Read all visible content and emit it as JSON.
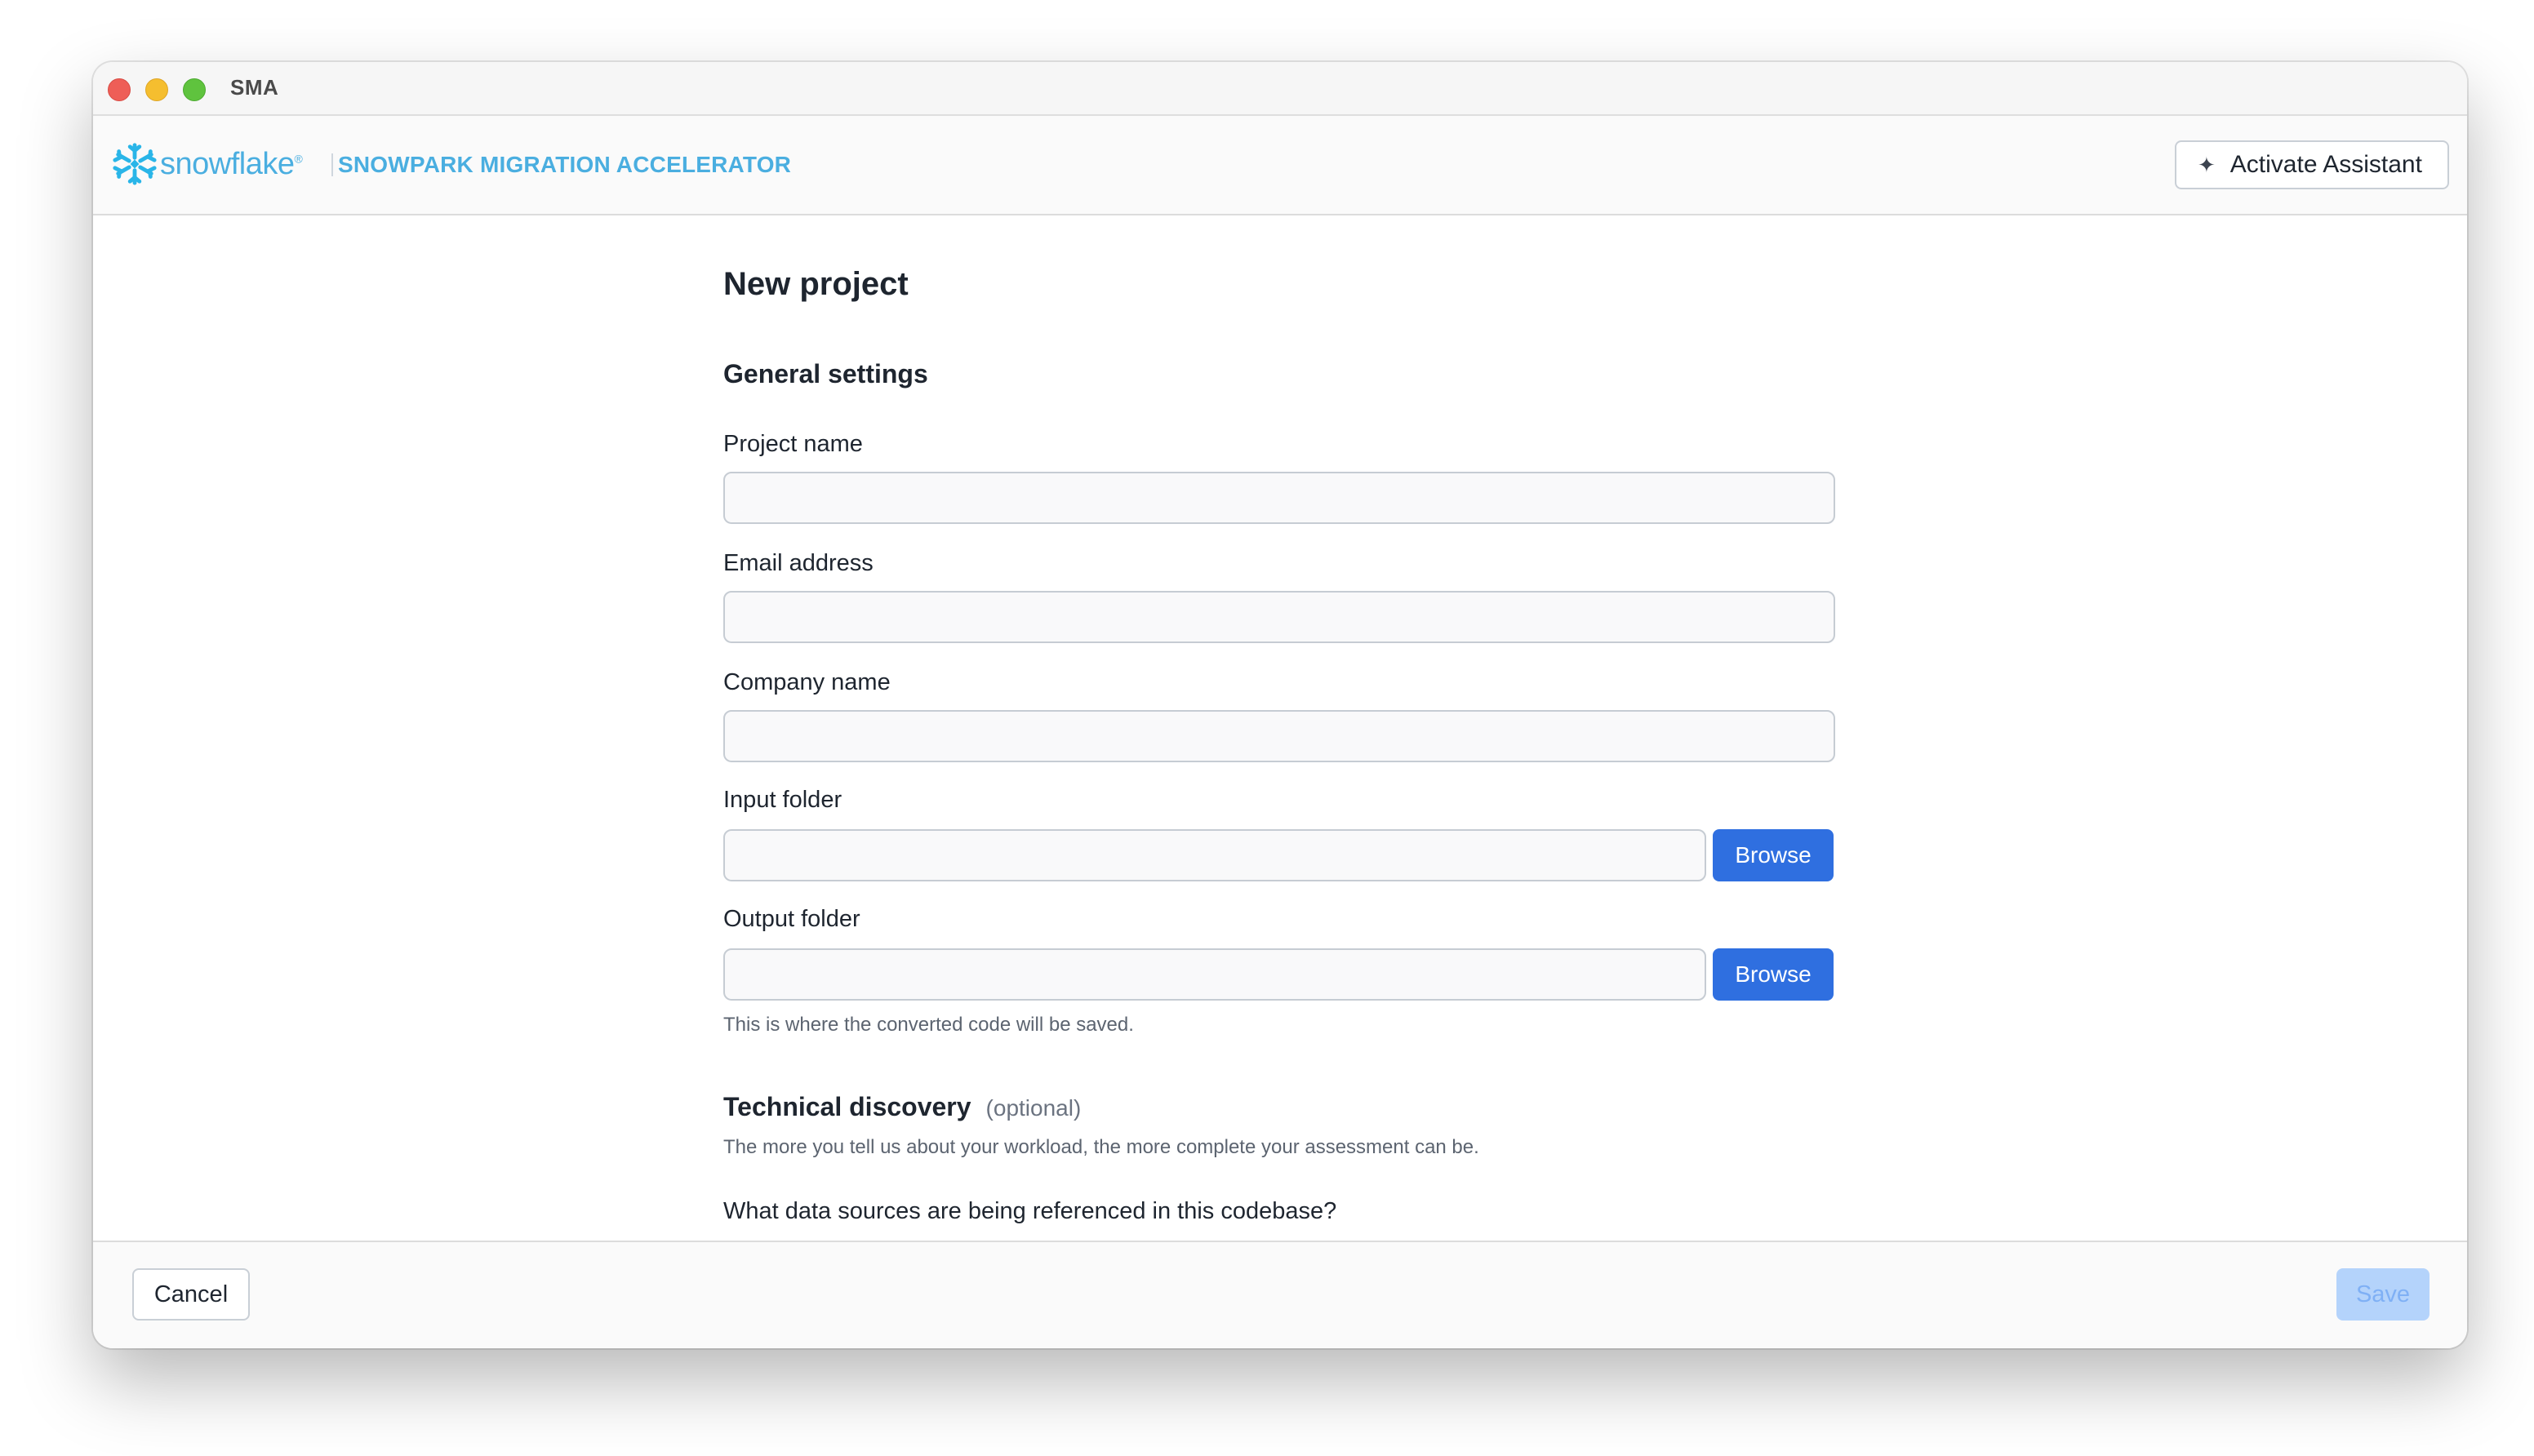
{
  "window": {
    "title": "SMA"
  },
  "header": {
    "logo_text": "snowflake",
    "product_name": "SNOWPARK MIGRATION ACCELERATOR",
    "assistant_button_label": "Activate Assistant",
    "assistant_icon": "sparkle-icon"
  },
  "form": {
    "title": "New project",
    "general_section_title": "General settings",
    "fields": {
      "project_name": {
        "label": "Project name",
        "value": ""
      },
      "email": {
        "label": "Email address",
        "value": ""
      },
      "company": {
        "label": "Company name",
        "value": ""
      },
      "input_folder": {
        "label": "Input folder",
        "value": "",
        "browse_label": "Browse"
      },
      "output_folder": {
        "label": "Output folder",
        "value": "",
        "browse_label": "Browse",
        "hint": "This is where the converted code will be saved."
      }
    },
    "technical": {
      "title": "Technical discovery",
      "optional_label": "(optional)",
      "description": "The more you tell us about your workload, the more complete your assessment can be.",
      "question": "What data sources are being referenced in this codebase?"
    }
  },
  "footer": {
    "cancel_label": "Cancel",
    "save_label": "Save",
    "save_enabled": false
  },
  "colors": {
    "brand": "#4aaee0",
    "primary_button": "#2f6fe0",
    "disabled_button": "#b4d3fb"
  }
}
